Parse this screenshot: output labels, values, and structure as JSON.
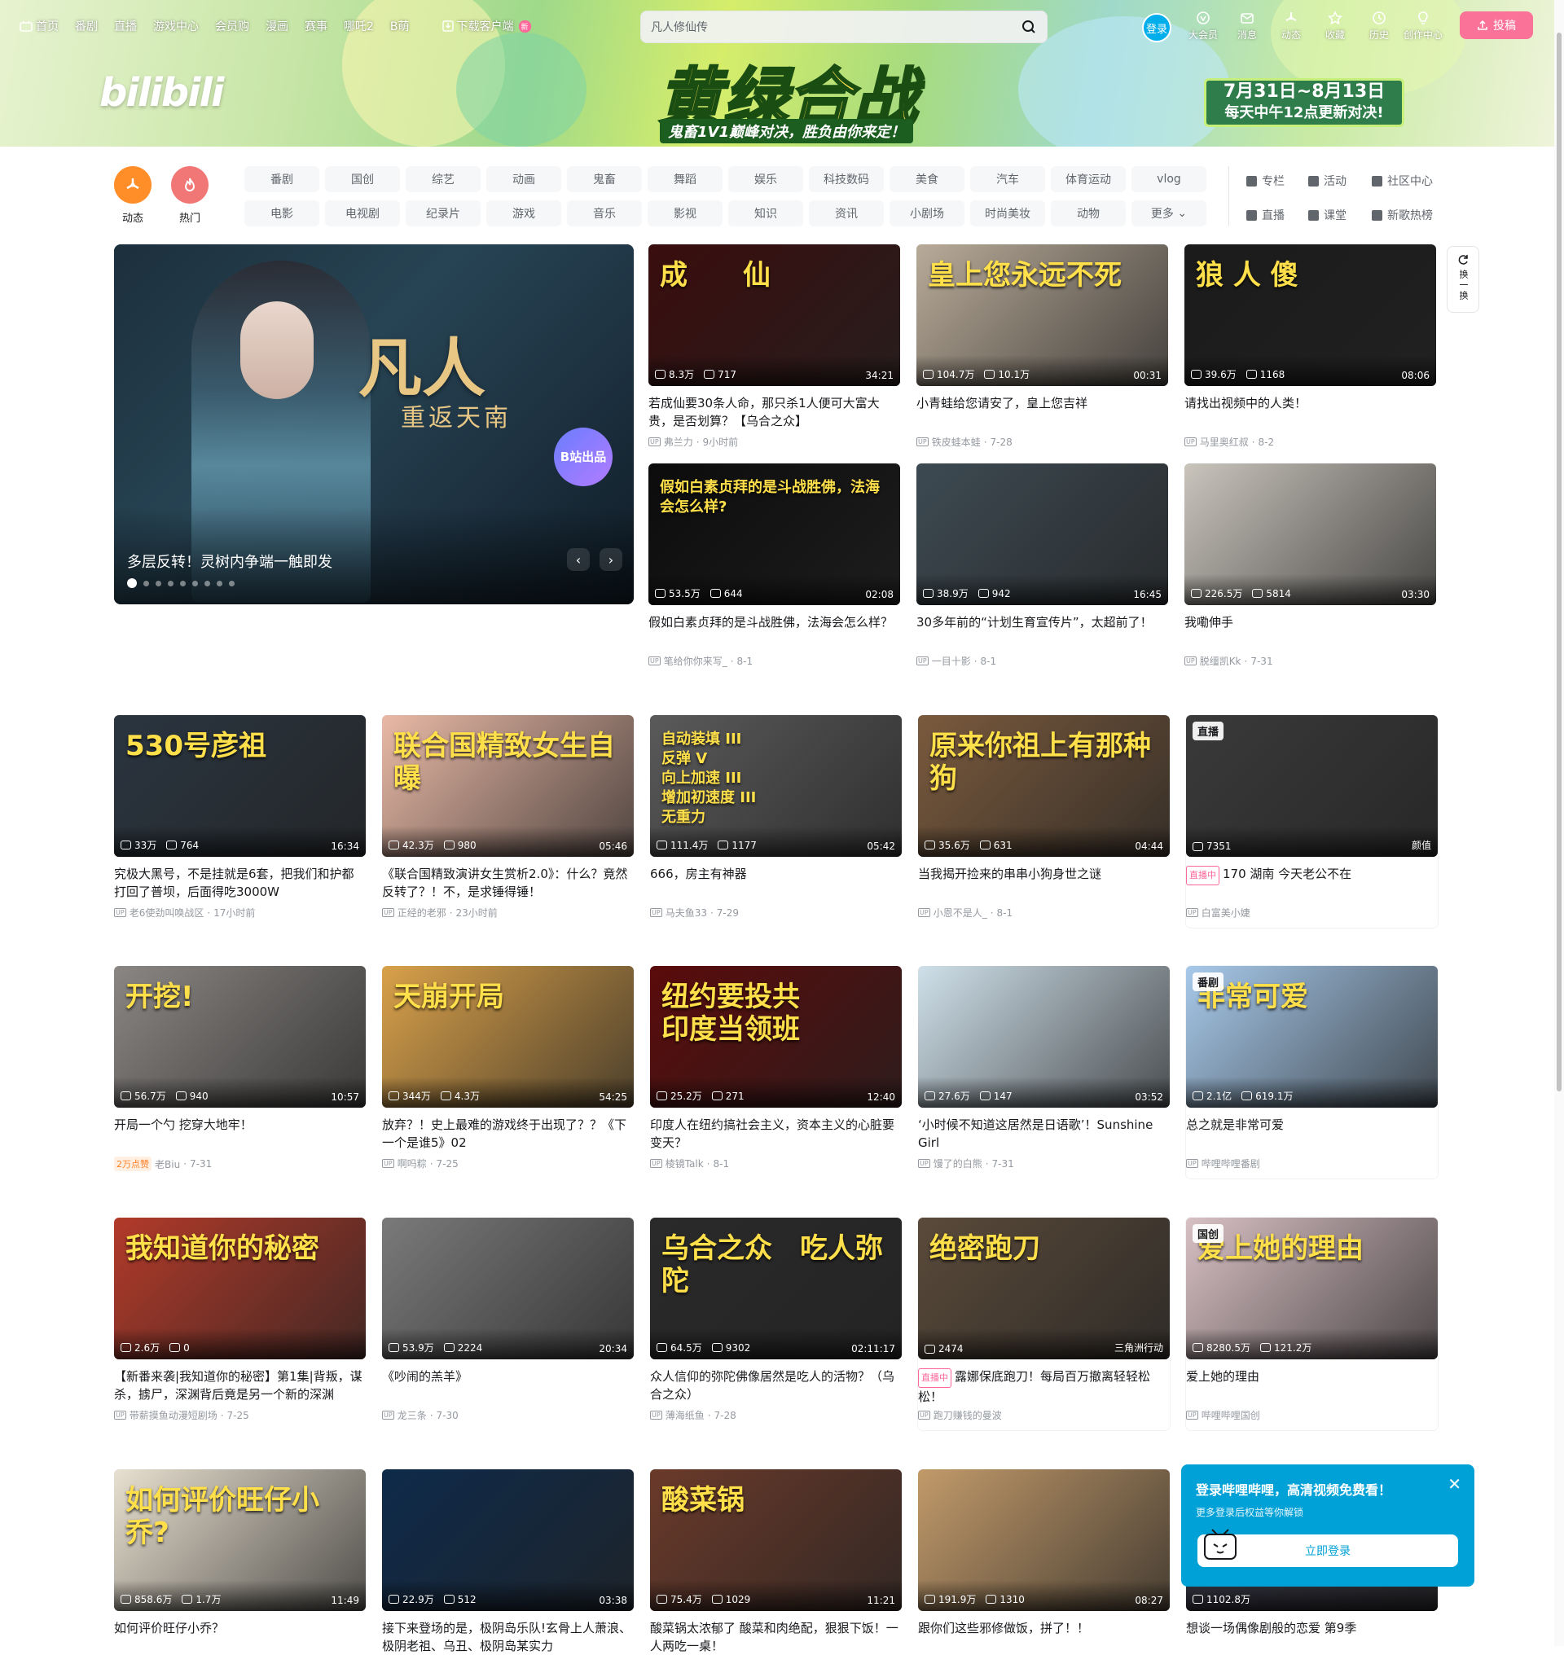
{
  "topnav": {
    "items": [
      "首页",
      "番剧",
      "直播",
      "游戏中心",
      "会员购",
      "漫画",
      "赛事",
      "哪吒2",
      "B萌"
    ],
    "download": "下载客户端",
    "download_badge": "新",
    "search_value": "凡人修仙传",
    "login": "登录",
    "right_items": [
      "大会员",
      "消息",
      "动态",
      "收藏",
      "历史",
      "创作中心"
    ],
    "upload": "投稿"
  },
  "banner": {
    "logo": "bilibili",
    "title": "黄绿合战",
    "subtitle": "鬼畜1V1巅峰对决，胜负由你来定！",
    "date_line1": "7月31日~8月13日",
    "date_line2": "每天中午12点更新对决!"
  },
  "channels": {
    "dynamic": "动态",
    "hot": "热门",
    "chips": [
      "番剧",
      "国创",
      "综艺",
      "动画",
      "鬼畜",
      "舞蹈",
      "娱乐",
      "科技数码",
      "美食",
      "汽车",
      "体育运动",
      "vlog",
      "电影",
      "电视剧",
      "纪录片",
      "游戏",
      "音乐",
      "影视",
      "知识",
      "资讯",
      "小剧场",
      "时尚美妆",
      "动物",
      "更多"
    ],
    "links": [
      "专栏",
      "活动",
      "社区中心",
      "直播",
      "课堂",
      "新歌热榜"
    ]
  },
  "carousel": {
    "title_art": "凡人",
    "subtitle_art": "重返天南",
    "badge": "B站出品",
    "caption": "多层反转！灵树内争端一触即发",
    "dots": 9,
    "active_dot": 0
  },
  "refresh": {
    "label": "换一换"
  },
  "cards": [
    {
      "views": "8.3万",
      "danmaku": "717",
      "duration": "34:21",
      "title": "若成仙要30条人命，那只杀1人便可大富大贵，是否划算？【乌合之众】",
      "author": "弗兰力",
      "date": "9小时前",
      "overlay": "成　　仙",
      "color": "#3a0d0d"
    },
    {
      "views": "104.7万",
      "danmaku": "10.1万",
      "duration": "00:31",
      "title": "小青蛙给您请安了，皇上您吉祥",
      "author": "铁皮蛙本蛙",
      "date": "7-28",
      "overlay": "皇上您永远不死",
      "color": "#b8aa98"
    },
    {
      "views": "39.6万",
      "danmaku": "1168",
      "duration": "08:06",
      "title": "请找出视频中的人类！",
      "author": "马里奥红叔",
      "date": "8-2",
      "overlay": "狼 人 傻",
      "color": "#1b1b1b"
    },
    {
      "views": "53.5万",
      "danmaku": "644",
      "duration": "02:08",
      "title": "假如白素贞拜的是斗战胜佛，法海会怎么样？",
      "author": "笔给你你来写_",
      "date": "8-1",
      "overlay": "假如白素贞拜的是斗战胜佛，法海会怎么样?",
      "color": "#0c0c0c"
    },
    {
      "views": "38.9万",
      "danmaku": "942",
      "duration": "16:45",
      "title": "30多年前的“计划生育宣传片”，太超前了！",
      "author": "一目十影",
      "date": "8-1",
      "overlay": "",
      "color": "#3d4a52"
    },
    {
      "views": "226.5万",
      "danmaku": "5814",
      "duration": "03:30",
      "title": "我嘞伸手",
      "author": "脱缰凯Kk",
      "date": "7-31",
      "overlay": "",
      "color": "#c9c4bc"
    },
    {
      "views": "33万",
      "danmaku": "764",
      "duration": "16:34",
      "title": "究极大黑号，不是挂就是6套，把我们和护都打回了普坝，后面得吃3000W",
      "author": "老6使劲叫唤战区",
      "date": "17小时前",
      "overlay": "530号彦祖",
      "color": "#2a3540"
    },
    {
      "views": "42.3万",
      "danmaku": "980",
      "duration": "05:46",
      "title": "《联合国精致演讲女生赏析2.0》：什么？竟然反转了？！不，是求锤得锤！",
      "author": "正经的老邪",
      "date": "23小时前",
      "overlay": "联合国精致女生自曝",
      "color": "#e9b9a6"
    },
    {
      "views": "111.4万",
      "danmaku": "1177",
      "duration": "05:42",
      "title": "666，房主有神器",
      "author": "马夫鱼33",
      "date": "7-29",
      "overlay": "自动装填 III\n反弹 V\n向上加速 III\n增加初速度 III\n无重力",
      "color": "#5a5a5a"
    },
    {
      "views": "35.6万",
      "danmaku": "631",
      "duration": "04:44",
      "title": "当我揭开捡来的串串小狗身世之谜",
      "author": "小恩不是人_",
      "date": "8-1",
      "overlay": "原来你祖上有那种狗",
      "color": "#7a5a3d"
    },
    {
      "views": "7351",
      "danmaku": "",
      "duration": "颜值",
      "title": "170 湖南 今天老公不在",
      "author": "白富美小婕",
      "date": "",
      "tag": "直播",
      "live": "直播中",
      "color": "#3a3a3a"
    },
    {
      "views": "56.7万",
      "danmaku": "940",
      "duration": "10:57",
      "title": "开局一个勺 挖穿大地牢！",
      "author": "老Biu",
      "date": "7-31",
      "likes": "2万点赞",
      "overlay": "开挖!",
      "color": "#8a8683"
    },
    {
      "views": "344万",
      "danmaku": "4.3万",
      "duration": "54:25",
      "title": "放弃？！史上最难的游戏终于出现了？？《下一个是谁5》02",
      "author": "啊吗粽",
      "date": "7-25",
      "overlay": "天崩开局",
      "color": "#d9a14a"
    },
    {
      "views": "25.2万",
      "danmaku": "271",
      "duration": "12:40",
      "title": "印度人在纽约搞社会主义，资本主义的心脏要变天？",
      "author": "棱镜Talk",
      "date": "8-1",
      "overlay": "纽约要投共\n印度当领班",
      "color": "#5a0b0b"
    },
    {
      "views": "27.6万",
      "danmaku": "147",
      "duration": "03:52",
      "title": "‘小时候不知道这居然是日语歌’！Sunshine Girl",
      "author": "馒了的白熊",
      "date": "7-31",
      "overlay": "",
      "color": "#cfe0ea"
    },
    {
      "views": "2.1亿",
      "danmaku": "619.1万",
      "duration": "",
      "title": "总之就是非常可爱",
      "author": "哔哩哔哩番剧",
      "date": "",
      "tag": "番剧",
      "overlay": "非常可爱",
      "color": "#a7c9ea"
    },
    {
      "views": "2.6万",
      "danmaku": "0",
      "duration": "",
      "title": "【新番来袭|我知道你的秘密】第1集|背叛，谋杀，掳尸，深渊背后竟是另一个新的深渊",
      "author": "带薪摸鱼动漫短剧场",
      "date": "7-25",
      "overlay": "我知道你的秘密",
      "color": "#b23a2a"
    },
    {
      "views": "53.9万",
      "danmaku": "2224",
      "duration": "20:34",
      "title": "《吵闹的羔羊》",
      "author": "龙三条",
      "date": "7-30",
      "overlay": "",
      "color": "#7a7a7a"
    },
    {
      "views": "64.5万",
      "danmaku": "9302",
      "duration": "02:11:17",
      "title": "众人信仰的弥陀佛像居然是吃人的活物？（乌合之众）",
      "author": "薄海纸鱼",
      "date": "7-28",
      "overlay": "乌合之众　吃人弥陀",
      "color": "#2a2a2a"
    },
    {
      "views": "2474",
      "danmaku": "",
      "duration": "三角洲行动",
      "title": "露娜保底跑刀！每局百万撤离轻轻松松！",
      "author": "跑刀赚钱的曼波",
      "date": "",
      "live": "直播中",
      "overlay": "绝密跑刀",
      "color": "#5a4a3a"
    },
    {
      "views": "8280.5万",
      "danmaku": "121.2万",
      "duration": "",
      "title": "爱上她的理由",
      "author": "哔哩哔哩国创",
      "date": "",
      "tag": "国创",
      "overlay": "爱上她的理由",
      "color": "#d8c0c4"
    },
    {
      "views": "858.6万",
      "danmaku": "1.7万",
      "duration": "11:49",
      "title": "如何评价旺仔小乔？",
      "author": "",
      "date": "",
      "overlay": "如何评价旺仔小乔?",
      "color": "#e8e0d0"
    },
    {
      "views": "22.9万",
      "danmaku": "512",
      "duration": "03:38",
      "title": "接下来登场的是，极阴岛乐队!玄骨上人萧浪、极阴老祖、乌丑、极阴岛某实力",
      "author": "",
      "date": "",
      "overlay": "",
      "color": "#0e2a4a"
    },
    {
      "views": "75.4万",
      "danmaku": "1029",
      "duration": "11:21",
      "title": "酸菜锅太浓郁了 酸菜和肉绝配，狠狠下饭！一人两吃一桌！",
      "author": "",
      "date": "",
      "overlay": "酸菜锅",
      "color": "#6a3a2a"
    },
    {
      "views": "191.9万",
      "danmaku": "1310",
      "duration": "08:27",
      "title": "跟你们这些邪修做饭，拼了！！",
      "author": "",
      "date": "",
      "overlay": "",
      "color": "#c29a6a"
    },
    {
      "views": "1102.8万",
      "danmaku": "",
      "duration": "",
      "title": "想谈一场偶像剧般的恋爱 第9季",
      "author": "",
      "date": "",
      "overlay": "",
      "color": "#3a3a4a"
    }
  ],
  "popup": {
    "title": "登录哔哩哔哩，高清视频免费看！",
    "subtitle": "更多登录后权益等你解锁",
    "button": "立即登录"
  }
}
